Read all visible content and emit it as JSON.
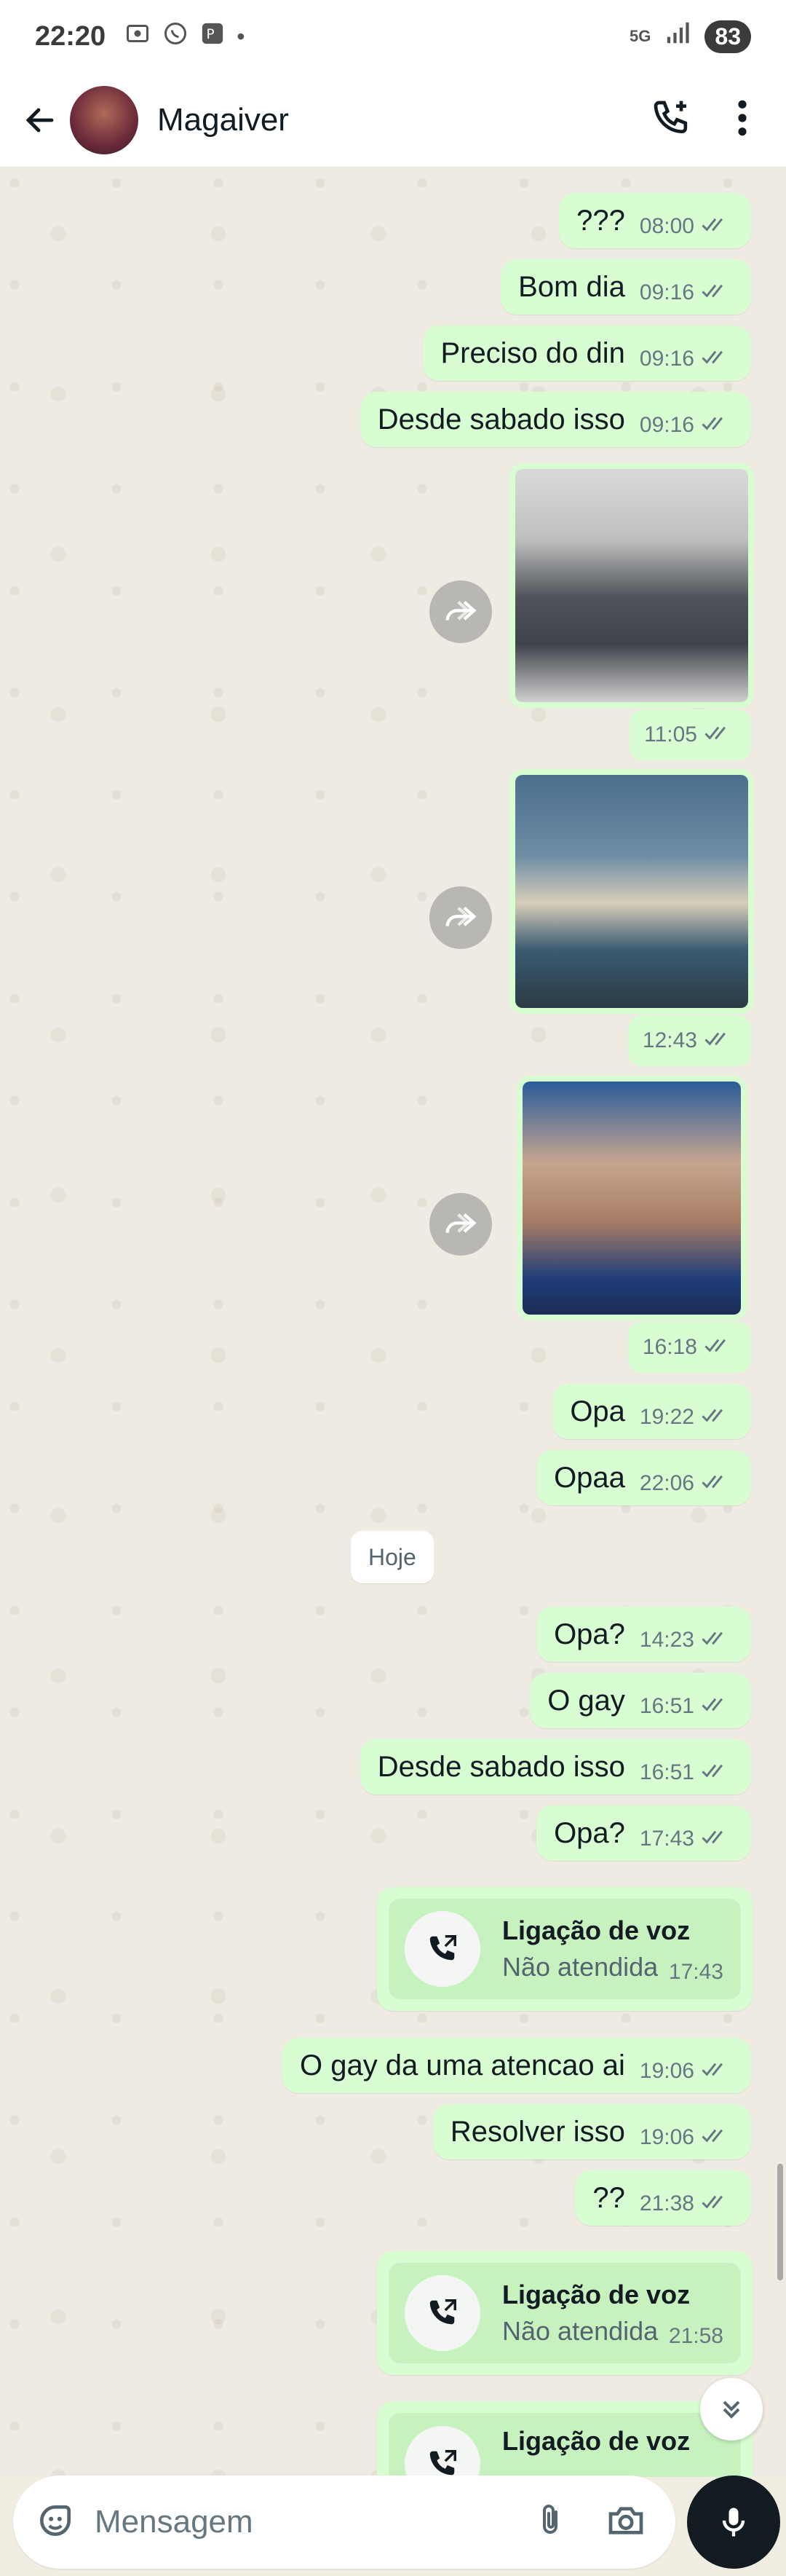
{
  "status_bar": {
    "time": "22:20",
    "network": "5G",
    "battery": "83"
  },
  "header": {
    "contact_name": "Magaiver"
  },
  "messages": [
    {
      "text": "???",
      "time": "08:00"
    },
    {
      "text": "Bom dia",
      "time": "09:16"
    },
    {
      "text": "Preciso do din",
      "time": "09:16"
    },
    {
      "text": "Desde sabado isso",
      "time": "09:16"
    }
  ],
  "media": [
    {
      "time": "11:05"
    },
    {
      "time": "12:43"
    },
    {
      "time": "16:18"
    }
  ],
  "messages2": [
    {
      "text": "Opa",
      "time": "19:22"
    },
    {
      "text": "Opaa",
      "time": "22:06"
    }
  ],
  "day_separator": "Hoje",
  "messages3": [
    {
      "text": "Opa?",
      "time": "14:23"
    },
    {
      "text": "O gay",
      "time": "16:51"
    },
    {
      "text": "Desde sabado isso",
      "time": "16:51"
    },
    {
      "text": "Opa?",
      "time": "17:43"
    }
  ],
  "call1": {
    "title": "Ligação de voz",
    "subtitle": "Não atendida",
    "time": "17:43"
  },
  "messages4": [
    {
      "text": "O gay da uma atencao ai",
      "time": "19:06"
    },
    {
      "text": "Resolver isso",
      "time": "19:06"
    },
    {
      "text": "??",
      "time": "21:38"
    }
  ],
  "call2": {
    "title": "Ligação de voz",
    "subtitle": "Não atendida",
    "time": "21:58"
  },
  "call3": {
    "title": "Ligação de voz"
  },
  "composer": {
    "placeholder": "Mensagem"
  },
  "colors": {
    "outgoing_bubble": "#d9fdd3",
    "chat_background": "#efeae2",
    "tick": "#667781"
  }
}
